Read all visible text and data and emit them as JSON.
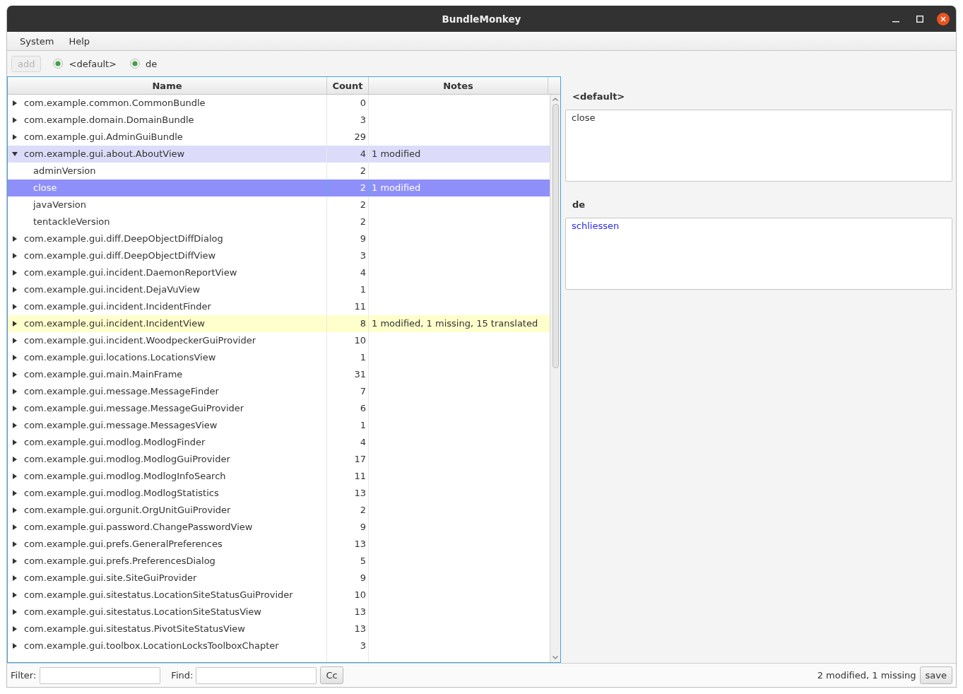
{
  "window": {
    "title": "BundleMonkey"
  },
  "menu": [
    "System",
    "Help"
  ],
  "toolbar": {
    "add_button": {
      "label": "add",
      "disabled": true
    },
    "languages": [
      {
        "label": "<default>",
        "checked": true
      },
      {
        "label": "de",
        "checked": true
      }
    ]
  },
  "table": {
    "columns": [
      "Name",
      "Count",
      "Notes"
    ],
    "rows": [
      {
        "name": "com.example.common.CommonBundle",
        "count": "0",
        "expanded": false,
        "selected": false
      },
      {
        "name": "com.example.domain.DomainBundle",
        "count": "3",
        "expanded": false,
        "selected": false
      },
      {
        "name": "com.example.gui.AdminGuiBundle",
        "count": "29",
        "expanded": false,
        "selected": false
      },
      {
        "name": "com.example.gui.about.AboutView",
        "count": "4",
        "notes": "1 modified",
        "expanded": true,
        "selected": false,
        "color": "#dcdcfa",
        "children": [
          {
            "name": "adminVersion",
            "count": "2",
            "selected": false
          },
          {
            "name": "close",
            "count": "2",
            "notes": "1 modified",
            "selected": true
          },
          {
            "name": "javaVersion",
            "count": "2",
            "selected": false
          },
          {
            "name": "tentackleVersion",
            "count": "2",
            "selected": false
          }
        ]
      },
      {
        "name": "com.example.gui.diff.DeepObjectDiffDialog",
        "count": "9",
        "expanded": false,
        "selected": false
      },
      {
        "name": "com.example.gui.diff.DeepObjectDiffView",
        "count": "3",
        "expanded": false,
        "selected": false
      },
      {
        "name": "com.example.gui.incident.DaemonReportView",
        "count": "4",
        "expanded": false,
        "selected": false
      },
      {
        "name": "com.example.gui.incident.DejaVuView",
        "count": "1",
        "expanded": false,
        "selected": false
      },
      {
        "name": "com.example.gui.incident.IncidentFinder",
        "count": "11",
        "expanded": false,
        "selected": false
      },
      {
        "name": "com.example.gui.incident.IncidentView",
        "count": "8",
        "notes": "1 modified, 1 missing, 15 translated",
        "expanded": false,
        "selected": false,
        "color": "#ffffcc"
      },
      {
        "name": "com.example.gui.incident.WoodpeckerGuiProvider",
        "count": "10",
        "expanded": false,
        "selected": false
      },
      {
        "name": "com.example.gui.locations.LocationsView",
        "count": "1",
        "expanded": false,
        "selected": false
      },
      {
        "name": "com.example.gui.main.MainFrame",
        "count": "31",
        "expanded": false,
        "selected": false
      },
      {
        "name": "com.example.gui.message.MessageFinder",
        "count": "7",
        "expanded": false,
        "selected": false
      },
      {
        "name": "com.example.gui.message.MessageGuiProvider",
        "count": "6",
        "expanded": false,
        "selected": false
      },
      {
        "name": "com.example.gui.message.MessagesView",
        "count": "1",
        "expanded": false,
        "selected": false
      },
      {
        "name": "com.example.gui.modlog.ModlogFinder",
        "count": "4",
        "expanded": false,
        "selected": false
      },
      {
        "name": "com.example.gui.modlog.ModlogGuiProvider",
        "count": "17",
        "expanded": false,
        "selected": false
      },
      {
        "name": "com.example.gui.modlog.ModlogInfoSearch",
        "count": "11",
        "expanded": false,
        "selected": false
      },
      {
        "name": "com.example.gui.modlog.ModlogStatistics",
        "count": "13",
        "expanded": false,
        "selected": false
      },
      {
        "name": "com.example.gui.orgunit.OrgUnitGuiProvider",
        "count": "2",
        "expanded": false,
        "selected": false
      },
      {
        "name": "com.example.gui.password.ChangePasswordView",
        "count": "9",
        "expanded": false,
        "selected": false
      },
      {
        "name": "com.example.gui.prefs.GeneralPreferences",
        "count": "13",
        "expanded": false,
        "selected": false
      },
      {
        "name": "com.example.gui.prefs.PreferencesDialog",
        "count": "5",
        "expanded": false,
        "selected": false
      },
      {
        "name": "com.example.gui.site.SiteGuiProvider",
        "count": "9",
        "expanded": false,
        "selected": false
      },
      {
        "name": "com.example.gui.sitestatus.LocationSiteStatusGuiProvider",
        "count": "10",
        "expanded": false,
        "selected": false
      },
      {
        "name": "com.example.gui.sitestatus.LocationSiteStatusView",
        "count": "13",
        "expanded": false,
        "selected": false
      },
      {
        "name": "com.example.gui.sitestatus.PivotSiteStatusView",
        "count": "13",
        "expanded": false,
        "selected": false
      },
      {
        "name": "com.example.gui.toolbox.LocationLocksToolboxChapter",
        "count": "3",
        "expanded": false,
        "selected": false
      }
    ]
  },
  "editor": {
    "entries": [
      {
        "label": "<default>",
        "value": "close",
        "modified": false
      },
      {
        "label": "de",
        "value": "schliessen",
        "modified": true
      }
    ]
  },
  "bottom_bar": {
    "filter_label": "Filter:",
    "find_label": "Find:",
    "case_button": "Cc",
    "status": "2 modified, 1 missing",
    "save_button": "save"
  }
}
